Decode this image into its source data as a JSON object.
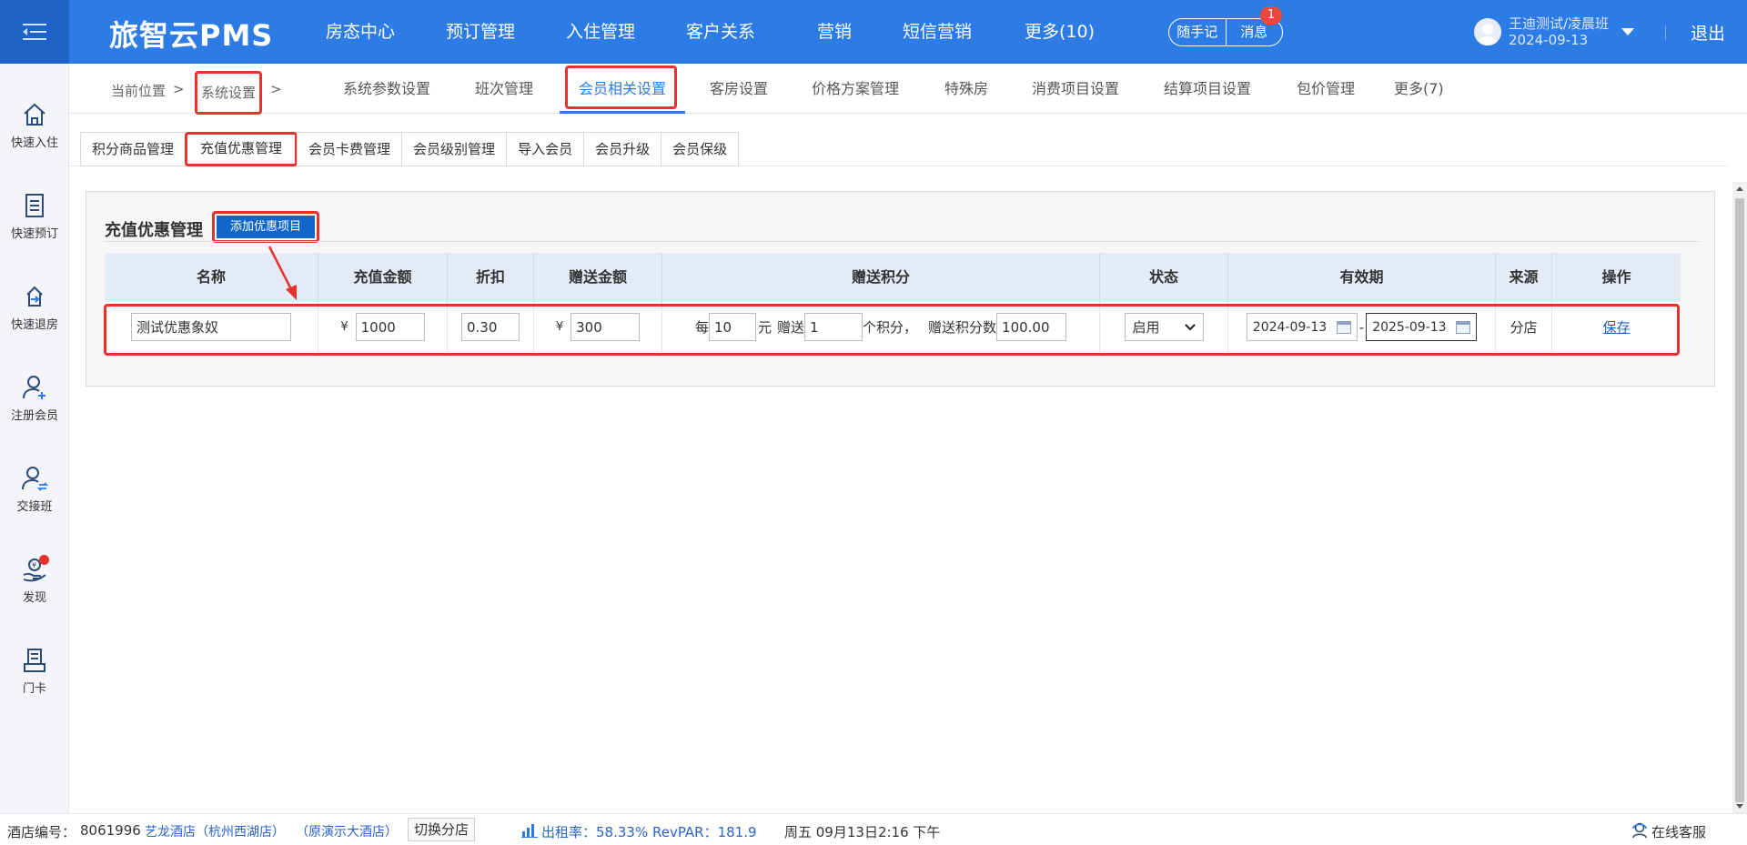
{
  "header": {
    "logo": "旅智云PMS",
    "nav": [
      "房态中心",
      "预订管理",
      "入住管理",
      "客户关系",
      "营销",
      "短信营销",
      "更多(10)"
    ],
    "notes_label": "随手记",
    "messages_label": "消息",
    "message_badge": "1",
    "user_name": "王迪测试/凌晨班",
    "user_date": "2024-09-13",
    "logout": "退出"
  },
  "sidebar": {
    "items": [
      {
        "label": "快速入住",
        "icon": "home-icon"
      },
      {
        "label": "快速预订",
        "icon": "document-list-icon"
      },
      {
        "label": "快速退房",
        "icon": "checkout-icon"
      },
      {
        "label": "注册会员",
        "icon": "add-user-icon"
      },
      {
        "label": "交接班",
        "icon": "shift-handover-icon"
      },
      {
        "label": "发现",
        "icon": "discover-hand-coin-icon"
      },
      {
        "label": "门卡",
        "icon": "door-card-icon"
      }
    ]
  },
  "breadcrumb": {
    "label": "当前位置",
    "sep": ">",
    "current": "系统设置"
  },
  "subtabs": [
    "系统参数设置",
    "班次管理",
    "会员相关设置",
    "客房设置",
    "价格方案管理",
    "特殊房",
    "消费项目设置",
    "结算项目设置",
    "包价管理",
    "更多(7)"
  ],
  "innertabs": [
    "积分商品管理",
    "充值优惠管理",
    "会员卡费管理",
    "会员级别管理",
    "导入会员",
    "会员升级",
    "会员保级"
  ],
  "panel": {
    "title": "充值优惠管理",
    "add_button": "添加优惠项目"
  },
  "table": {
    "headers": [
      "名称",
      "充值金额",
      "折扣",
      "赠送金额",
      "赠送积分",
      "状态",
      "有效期",
      "来源",
      "操作"
    ],
    "row": {
      "name": "测试优惠象奴",
      "currency": "¥",
      "amount": "1000",
      "discount": "0.30",
      "gift_amount": "300",
      "points_prefix": "每",
      "points_every": "10",
      "points_unit": "元",
      "points_give_label": "赠送",
      "points_give": "1",
      "points_suffix": "个积分，",
      "points_total_label": "赠送积分数",
      "points_total": "100.00",
      "status": "启用",
      "date_from": "2024-09-13",
      "date_sep": "-",
      "date_to": "2025-09-13",
      "source": "分店",
      "action": "保存"
    }
  },
  "footer": {
    "hotel_no_label": "酒店编号：",
    "hotel_no": "8061996",
    "hotel_name": "艺龙酒店（杭州西湖店）",
    "hotel_alias": "（原演示大酒店）",
    "switch": "切换分店",
    "occupancy": "出租率：58.33% RevPAR：181.9",
    "datetime": "周五 09月13日2:16 下午",
    "service": "在线客服"
  },
  "colors": {
    "header_bg": "#2d7be5",
    "highlight": "#e5322d",
    "button_bg": "#1167c9",
    "link": "#1c62c4"
  }
}
